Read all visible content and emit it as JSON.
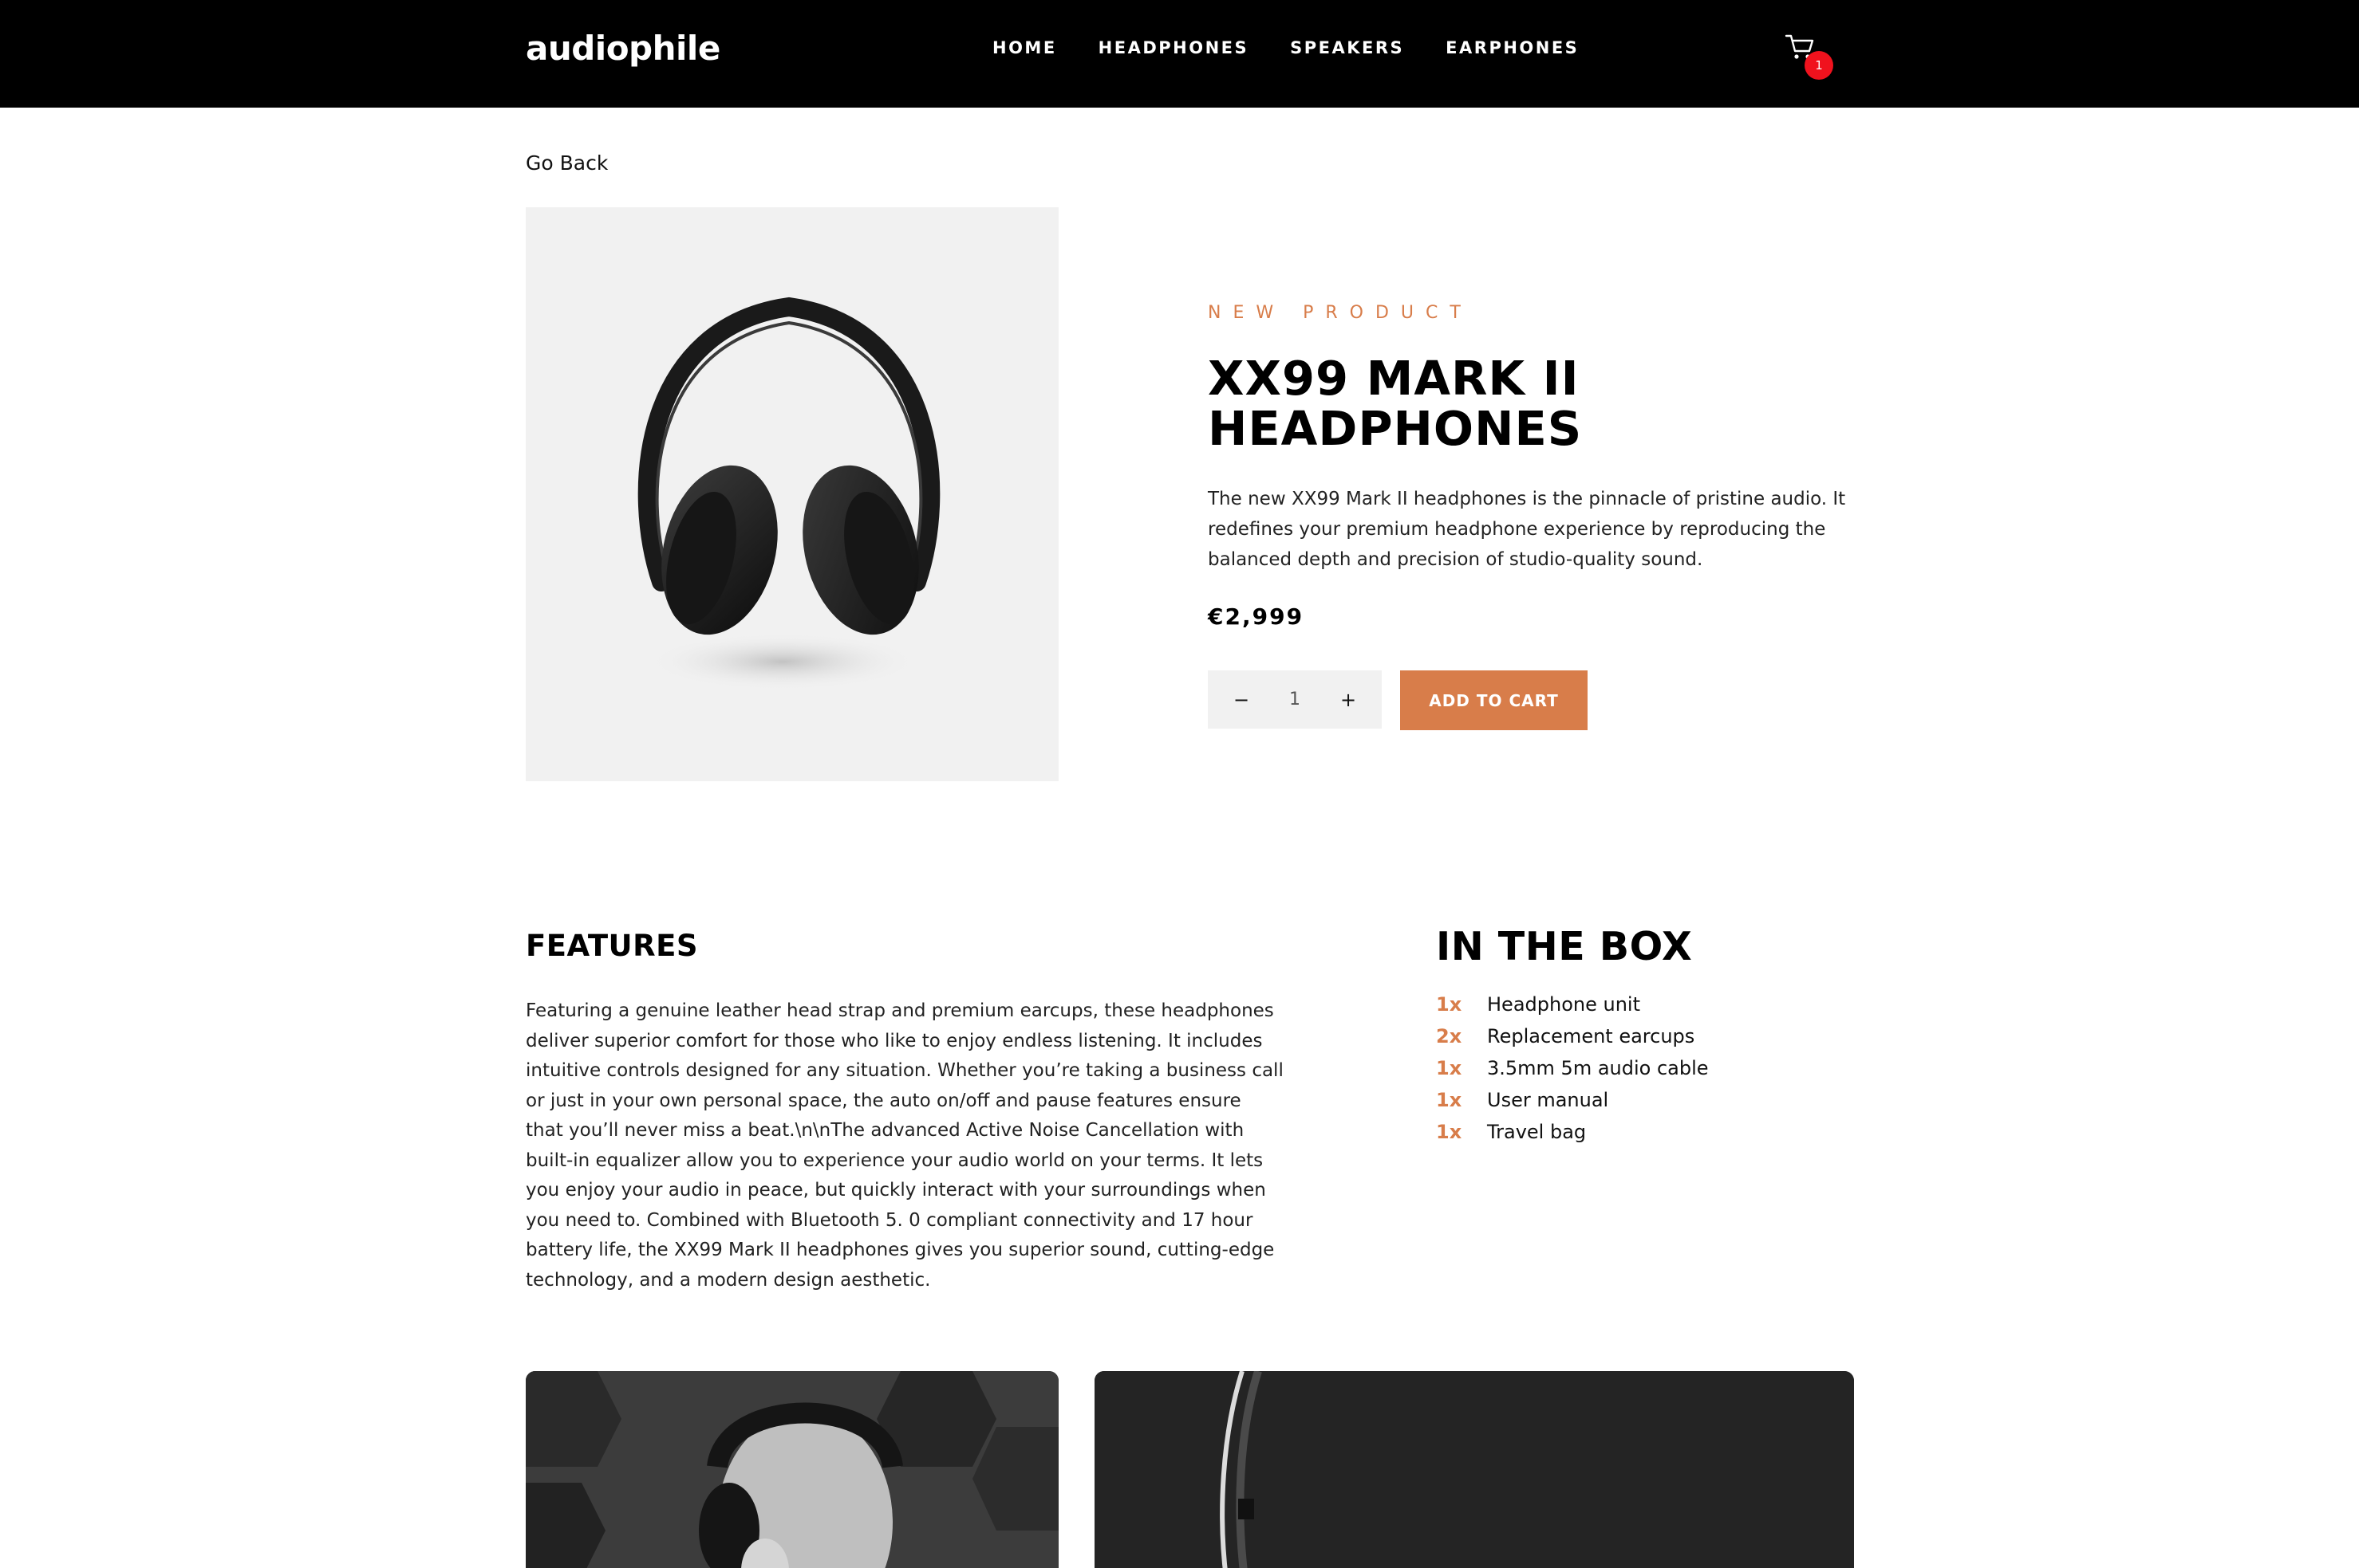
{
  "header": {
    "logo": "audiophile",
    "nav": [
      "HOME",
      "HEADPHONES",
      "SPEAKERS",
      "EARPHONES"
    ],
    "cart_icon": "cart-icon",
    "cart_count": "1"
  },
  "go_back": "Go Back",
  "product": {
    "overline": "NEW PRODUCT",
    "title_line1": "XX99 MARK II",
    "title_line2": "HEADPHONES",
    "description": "The new XX99 Mark II headphones is the pinnacle of pristine audio. It redefines your premium headphone experience by reproducing the balanced depth and precision of studio-quality sound.",
    "price": "€2,999",
    "quantity": "1",
    "decrement": "−",
    "increment": "+",
    "add_to_cart": "ADD TO CART"
  },
  "features": {
    "title": "FEATURES",
    "text": "Featuring a genuine leather head strap and premium earcups, these headphones deliver superior comfort for those who like to enjoy endless listening. It includes intuitive controls designed for any situation. Whether you’re taking a business call or just in your own personal space, the auto on/off and pause features ensure that you’ll never miss a beat.\\n\\nThe advanced Active Noise Cancellation with built-in equalizer allow you to experience your audio world on your terms. It lets you enjoy your audio in peace, but quickly interact with your surroundings when you need to. Combined with Bluetooth 5. 0 compliant connectivity and 17 hour battery life, the XX99 Mark II headphones gives you superior sound, cutting-edge technology, and a modern design aesthetic."
  },
  "in_the_box": {
    "title": "IN THE BOX",
    "items": [
      {
        "qty": "1x",
        "name": "Headphone unit"
      },
      {
        "qty": "2x",
        "name": "Replacement earcups"
      },
      {
        "qty": "1x",
        "name": "3.5mm 5m audio cable"
      },
      {
        "qty": "1x",
        "name": "User manual"
      },
      {
        "qty": "1x",
        "name": "Travel bag"
      }
    ]
  },
  "colors": {
    "accent": "#d87d4a",
    "header_bg": "#000000",
    "badge": "#f0121d",
    "image_bg": "#f1f1f1"
  }
}
